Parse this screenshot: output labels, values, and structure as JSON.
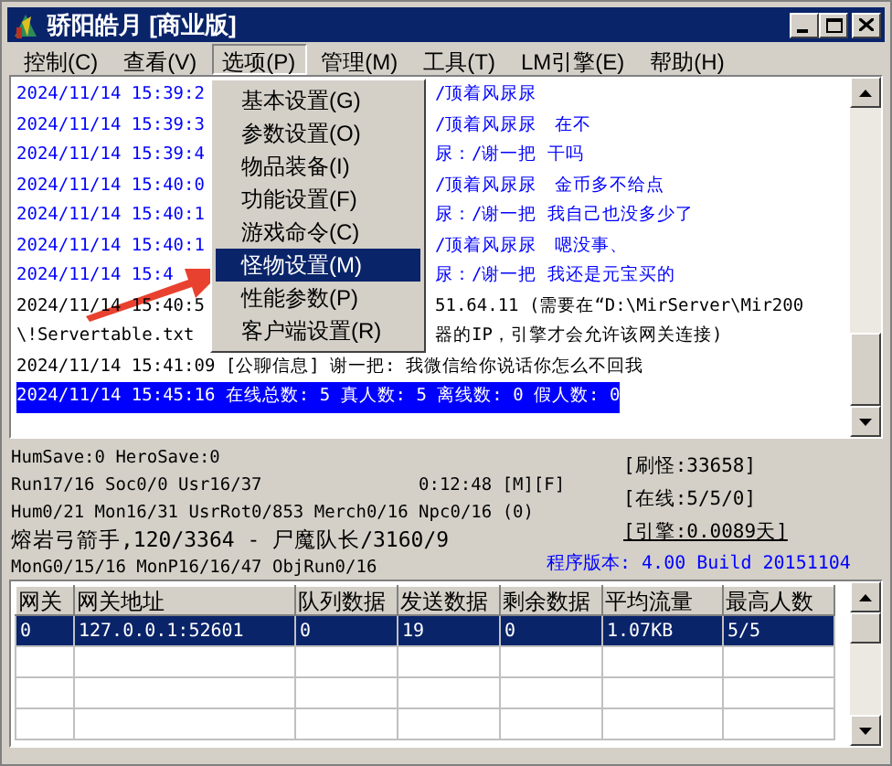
{
  "window": {
    "title": "骄阳皓月 [商业版]"
  },
  "menu_bar": [
    {
      "label": "控制(C)",
      "selected": false
    },
    {
      "label": "查看(V)",
      "selected": false
    },
    {
      "label": "选项(P)",
      "selected": true
    },
    {
      "label": "管理(M)",
      "selected": false
    },
    {
      "label": "工具(T)",
      "selected": false
    },
    {
      "label": "LM引擎(E)",
      "selected": false
    },
    {
      "label": "帮助(H)",
      "selected": false
    }
  ],
  "dropdown": [
    {
      "label": "基本设置(G)",
      "selected": false
    },
    {
      "label": "参数设置(O)",
      "selected": false
    },
    {
      "label": "物品装备(I)",
      "selected": false
    },
    {
      "label": "功能设置(F)",
      "selected": false
    },
    {
      "label": "游戏命令(C)",
      "selected": false
    },
    {
      "label": "怪物设置(M)",
      "selected": true
    },
    {
      "label": "性能参数(P)",
      "selected": false
    },
    {
      "label": "客户端设置(R)",
      "selected": false
    }
  ],
  "log": [
    {
      "kind": "split",
      "left": "2024/11/14 15:39:2",
      "right": "/顶着风尿尿",
      "color": "#0000ff",
      "selected": false
    },
    {
      "kind": "split",
      "left": "2024/11/14 15:39:3",
      "right": "/顶着风尿尿　在不",
      "color": "#0000ff",
      "selected": false
    },
    {
      "kind": "split",
      "left": "2024/11/14 15:39:4",
      "right": "尿：/谢一把 干吗",
      "color": "#0000ff",
      "selected": false
    },
    {
      "kind": "split",
      "left": "2024/11/14 15:40:0",
      "right": "/顶着风尿尿　金币多不给点",
      "color": "#0000ff",
      "selected": false
    },
    {
      "kind": "split",
      "left": "2024/11/14 15:40:1",
      "right": "尿：/谢一把 我自己也没多少了",
      "color": "#0000ff",
      "selected": false
    },
    {
      "kind": "split",
      "left": "2024/11/14 15:40:1",
      "right": "/顶着风尿尿　嗯没事、",
      "color": "#0000ff",
      "selected": false
    },
    {
      "kind": "split",
      "left": "2024/11/14 15:4",
      "right": "尿：/谢一把 我还是元宝买的",
      "color": "#0000ff",
      "selected": false
    },
    {
      "kind": "split",
      "left": "2024/11/14 15:40:5",
      "right": "51.64.11 (需要在“D:\\MirServer\\Mir200",
      "color": "#000000",
      "selected": false
    },
    {
      "kind": "split",
      "left": "\\!Servertable.txt",
      "right": "器的IP，引擎才会允许该网关连接)",
      "color": "#000000",
      "selected": false
    },
    {
      "kind": "full",
      "text": "2024/11/14 15:41:09 [公聊信息] 谢一把: 我微信给你说话你怎么不回我",
      "color": "#000000",
      "selected": false
    },
    {
      "kind": "full",
      "text": "2024/11/14 15:45:16 在线总数: 5 真人数: 5 离线数: 0 假人数: 0",
      "selected": true
    }
  ],
  "status": {
    "lines": [
      "HumSave:0 HeroSave:0",
      "Run17/16 Soc0/0 Usr16/37",
      "Hum0/21 Mon16/31 UsrRot0/853 Merch0/16 Npc0/16 (0)",
      "熔岩弓箭手,120/3364 - 尸魔队长/3160/9",
      "MonG0/15/16 MonP16/16/47 ObjRun0/16"
    ],
    "time": "0:12:48 [M][F]",
    "counters": [
      {
        "text": "[刷怪:33658]",
        "underlined": false
      },
      {
        "text": "[在线:5/5/0]",
        "underlined": false
      },
      {
        "text": "[引擎:0.0089天]",
        "underlined": true
      }
    ],
    "version": "程序版本: 4.00 Build 20151104"
  },
  "table": {
    "columns": [
      "网关",
      "网关地址",
      "队列数据",
      "发送数据",
      "剩余数据",
      "平均流量",
      "最高人数"
    ],
    "rows": [
      {
        "cells": [
          "0",
          "127.0.0.1:52601",
          "0",
          "19",
          "0",
          "1.07KB",
          "5/5"
        ],
        "selected": true
      }
    ]
  }
}
